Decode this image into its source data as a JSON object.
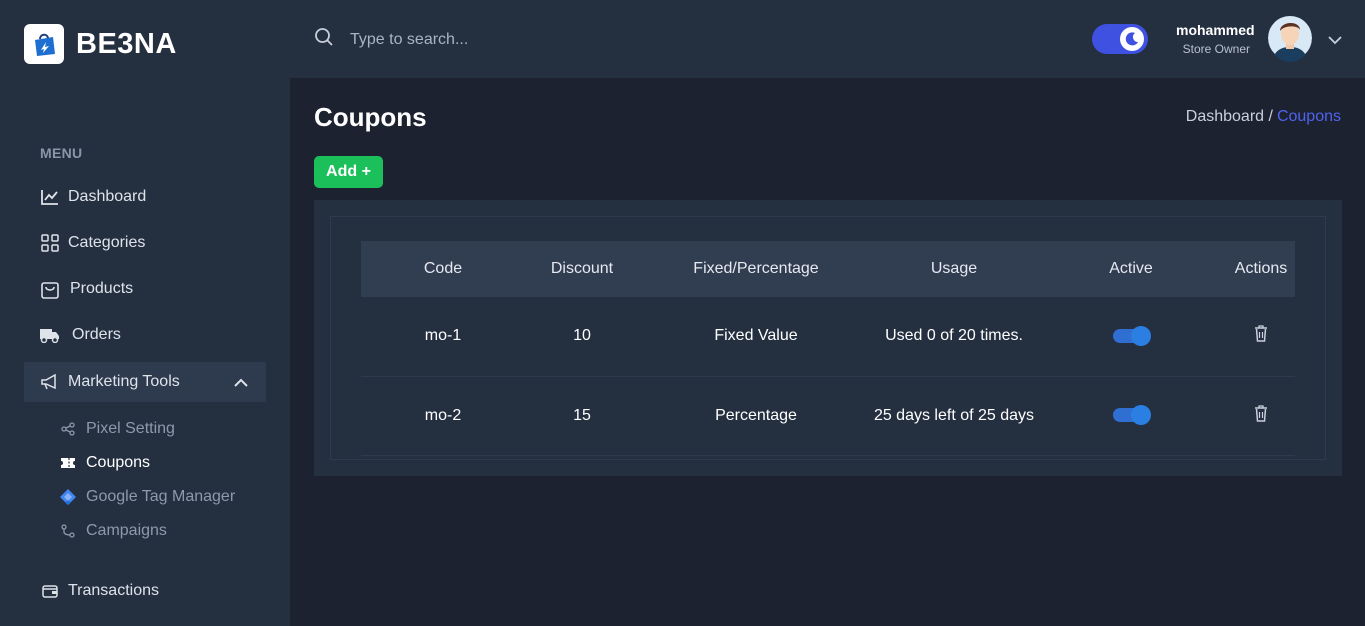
{
  "brand": {
    "name": "BE3NA"
  },
  "sidebar": {
    "menu_title": "MENU",
    "items": [
      {
        "label": "Dashboard",
        "icon": "chart-line-icon"
      },
      {
        "label": "Categories",
        "icon": "grid-icon"
      },
      {
        "label": "Products",
        "icon": "shopping-bag-icon"
      },
      {
        "label": "Orders",
        "icon": "truck-icon"
      },
      {
        "label": "Marketing Tools",
        "icon": "megaphone-icon",
        "expanded": true
      }
    ],
    "subitems": [
      {
        "label": "Pixel Setting",
        "icon": "share-nodes-icon"
      },
      {
        "label": "Coupons",
        "icon": "ticket-icon",
        "current": true
      },
      {
        "label": "Google Tag Manager",
        "icon": "google-tag-manager-icon"
      },
      {
        "label": "Campaigns",
        "icon": "route-icon"
      }
    ],
    "bottom_item": {
      "label": "Transactions",
      "icon": "wallet-icon"
    }
  },
  "header": {
    "search_placeholder": "Type to search...",
    "dark_mode": true,
    "user": {
      "name": "mohammed",
      "role": "Store Owner"
    }
  },
  "page": {
    "title": "Coupons",
    "breadcrumb": {
      "parent": "Dashboard /",
      "current": "Coupons"
    },
    "add_button": "Add +"
  },
  "table": {
    "headers": [
      "Code",
      "Discount",
      "Fixed/Percentage",
      "Usage",
      "Active",
      "Actions"
    ],
    "rows": [
      {
        "code": "mo-1",
        "discount": "10",
        "type": "Fixed Value",
        "usage": "Used 0 of 20 times.",
        "active": true
      },
      {
        "code": "mo-2",
        "discount": "15",
        "type": "Percentage",
        "usage": "25 days left of 25 days",
        "active": true
      }
    ]
  },
  "colors": {
    "sidebar_bg": "#242f40",
    "page_bg": "#1c2230",
    "accent": "#3f51e0",
    "breadcrumb_current": "#4f63ef",
    "add_button": "#1cc05a",
    "switch_on": "#2b7fe3"
  }
}
